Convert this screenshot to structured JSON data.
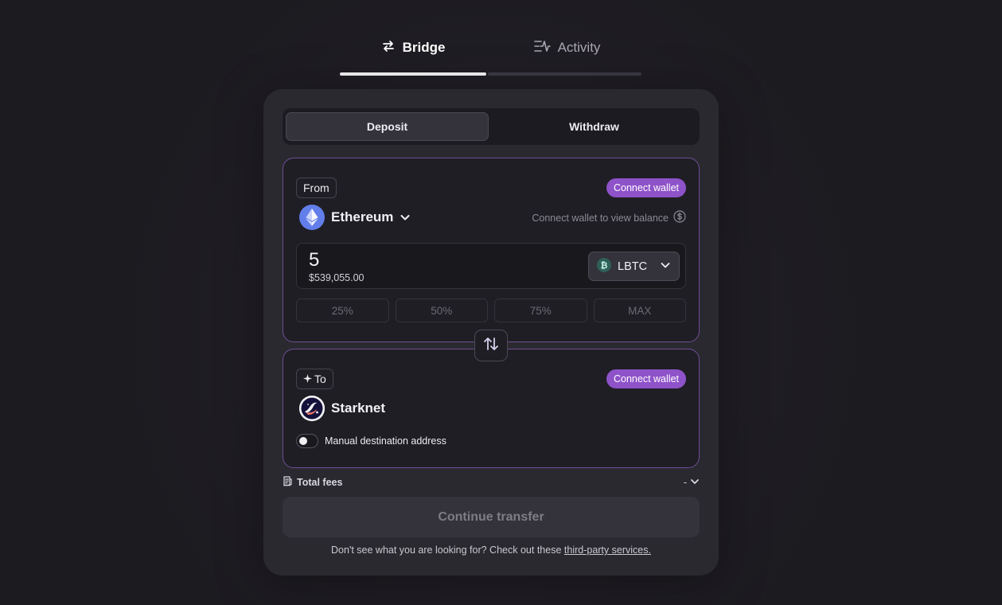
{
  "nav": {
    "tabs": [
      {
        "label": "Bridge",
        "icon": "arrows-swap-icon",
        "active": true
      },
      {
        "label": "Activity",
        "icon": "activity-icon",
        "active": false
      }
    ]
  },
  "mode": {
    "deposit_label": "Deposit",
    "withdraw_label": "Withdraw",
    "selected": "Deposit"
  },
  "from": {
    "label": "From",
    "connect_label": "Connect wallet",
    "chain": "Ethereum",
    "balance_hint": "Connect wallet to view balance",
    "amount": "5",
    "amount_usd": "$539,055.00",
    "token": "LBTC",
    "percent_options": [
      "25%",
      "50%",
      "75%",
      "MAX"
    ]
  },
  "to": {
    "label": "To",
    "connect_label": "Connect wallet",
    "chain": "Starknet",
    "manual_address_label": "Manual destination address",
    "manual_address_enabled": false
  },
  "fees": {
    "label": "Total fees",
    "value": "-"
  },
  "actions": {
    "continue_label": "Continue transfer"
  },
  "footer": {
    "prefix": "Don't see what you are looking for? Check out these",
    "link_text": "third-party services."
  },
  "colors": {
    "accent": "#8e52c9",
    "panel_border": "#6f4e95",
    "ethereum": "#627eea"
  }
}
